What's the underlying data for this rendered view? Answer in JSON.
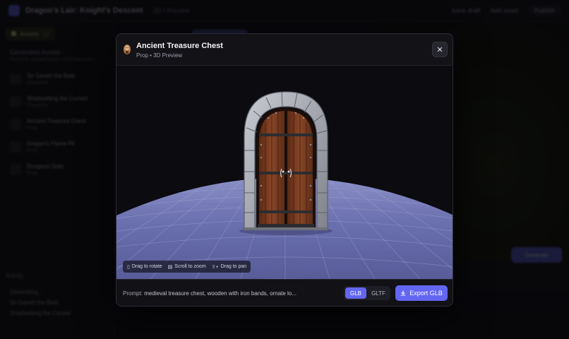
{
  "app": {
    "title": "Dragon's Lair: Knight's Descent",
    "subtitle": "3D • Preview",
    "actions": [
      "Save draft",
      "Add asset",
      "Publish"
    ]
  },
  "sidebar": {
    "tab_label": "Assets",
    "tab_count": "12",
    "heading": "Generated Assets",
    "subheading": "Recently created props and characters",
    "items": [
      {
        "name": "Sir Gareth the Bold",
        "kind": "Character"
      },
      {
        "name": "Shadowfang the Cursed",
        "kind": "Character"
      },
      {
        "name": "Ancient Treasure Chest",
        "kind": "Prop"
      },
      {
        "name": "Dragon's Flame Pit",
        "kind": "Prop"
      },
      {
        "name": "Dungeon Gate",
        "kind": "Prop"
      }
    ],
    "section_title": "Activity",
    "log": [
      "Generating...",
      "Sir Gareth the Bold",
      "Shadowfang the Cursed"
    ]
  },
  "main": {
    "generate_label": "Generate"
  },
  "modal": {
    "title": "Ancient Treasure Chest",
    "subtitle": "Prop • 3D Preview",
    "close_label": "✕",
    "hints": [
      {
        "icon": "▯",
        "label": "Drag to rotate"
      },
      {
        "icon": "▤",
        "label": "Scroll to zoom"
      },
      {
        "icon": "⇧+",
        "label": "Drag to pan"
      }
    ],
    "prompt_label": "Prompt:",
    "prompt_value": "medieval treasure chest, wooden with iron bands, ornate lo...",
    "formats": [
      "GLB",
      "GLTF"
    ],
    "selected_format": "GLB",
    "export_label": "Export GLB"
  },
  "colors": {
    "accent": "#6366f1",
    "ground": "#5b5f9e",
    "stone": "#9a9ca6",
    "wood": "#7a3e22"
  }
}
